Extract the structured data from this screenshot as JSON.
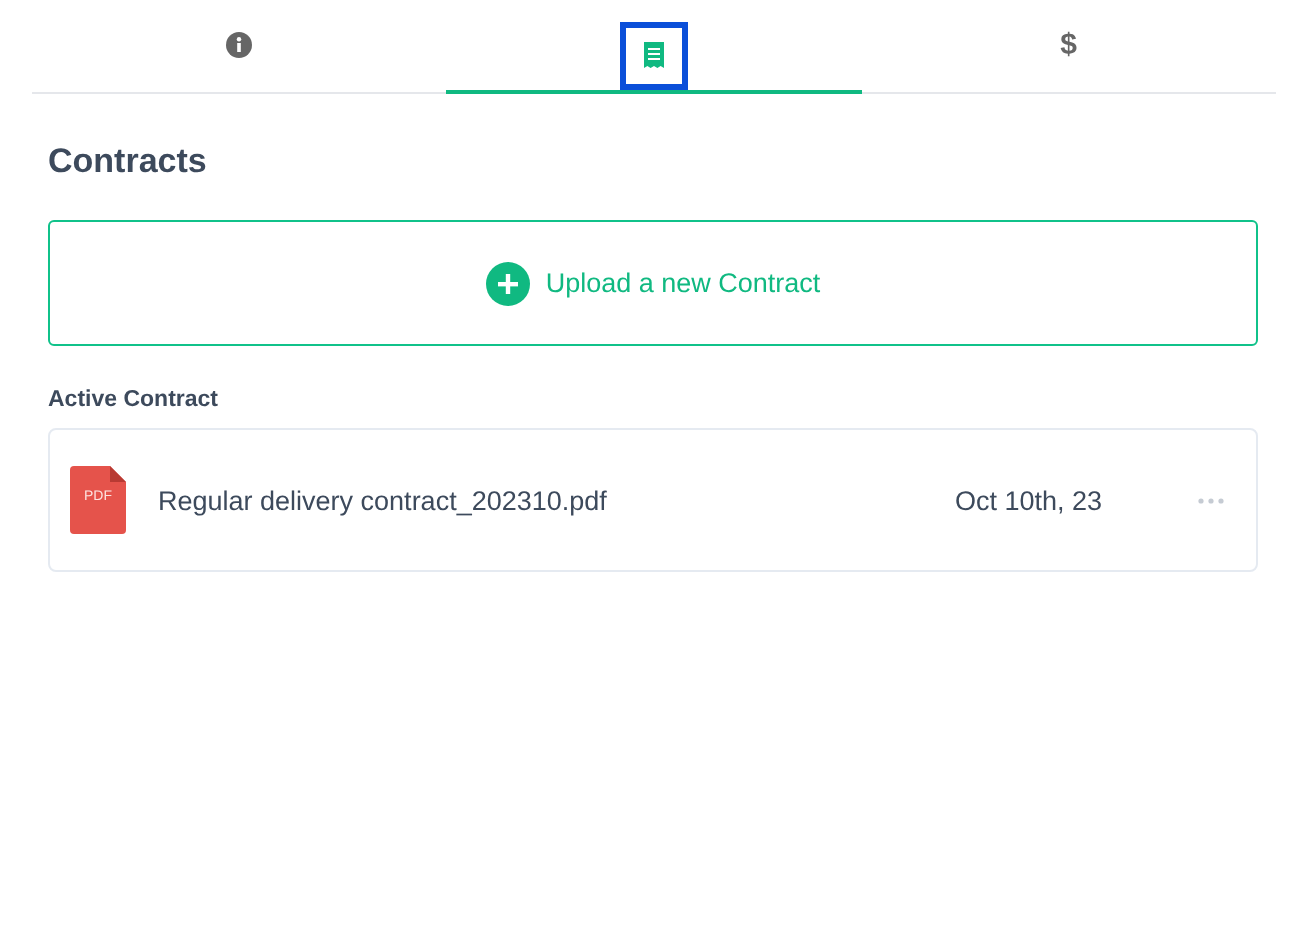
{
  "tabs": [
    {
      "kind": "info",
      "selected": false
    },
    {
      "kind": "receipt",
      "selected": true
    },
    {
      "kind": "dollar",
      "label": "$",
      "selected": false
    }
  ],
  "heading": "Contracts",
  "upload_button": {
    "label": "Upload a new Contract"
  },
  "section_label": "Active Contract",
  "contracts": [
    {
      "file_type": "PDF",
      "name": "Regular delivery contract_202310.pdf",
      "date": "Oct 10th, 23"
    }
  ]
}
